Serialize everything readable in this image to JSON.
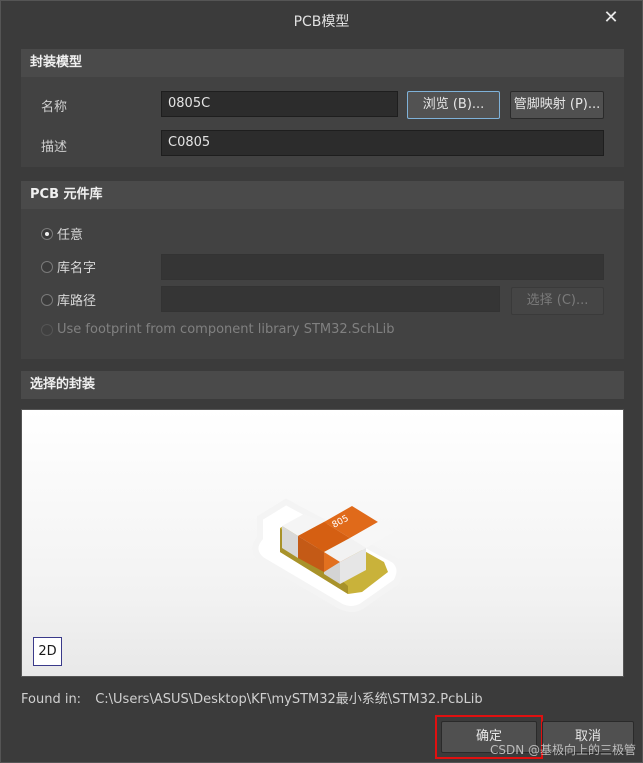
{
  "window": {
    "title": "PCB模型",
    "close_glyph": "✕"
  },
  "footprint_model": {
    "header": "封装模型",
    "name_label": "名称",
    "name_value": "0805C",
    "browse_button": "浏览 (B)...",
    "pin_map_button": "管脚映射 (P)...",
    "desc_label": "描述",
    "desc_value": "C0805"
  },
  "pcb_library": {
    "header": "PCB 元件库",
    "options": [
      {
        "label": "任意",
        "checked": true,
        "enabled": true
      },
      {
        "label": "库名字",
        "checked": false,
        "enabled": true
      },
      {
        "label": "库路径",
        "checked": false,
        "enabled": true
      },
      {
        "label": "Use footprint from component library STM32.SchLib",
        "checked": false,
        "enabled": false
      }
    ],
    "lib_name_value": "",
    "lib_path_value": "",
    "choose_button": "选择 (C)..."
  },
  "selected_footprint": {
    "header": "选择的封装",
    "component_marking": "805",
    "view_toggle": "2D"
  },
  "found_in": {
    "label": "Found in:",
    "path": "C:\\Users\\ASUS\\Desktop\\KF\\mySTM32最小系统\\STM32.PcbLib"
  },
  "actions": {
    "ok": "确定",
    "cancel": "取消"
  },
  "watermark": "CSDN @基极向上的三极管",
  "colors": {
    "highlight_box": "#e01010",
    "component_orange": "#e06a1a",
    "pad_yellow": "#c9b23a"
  }
}
